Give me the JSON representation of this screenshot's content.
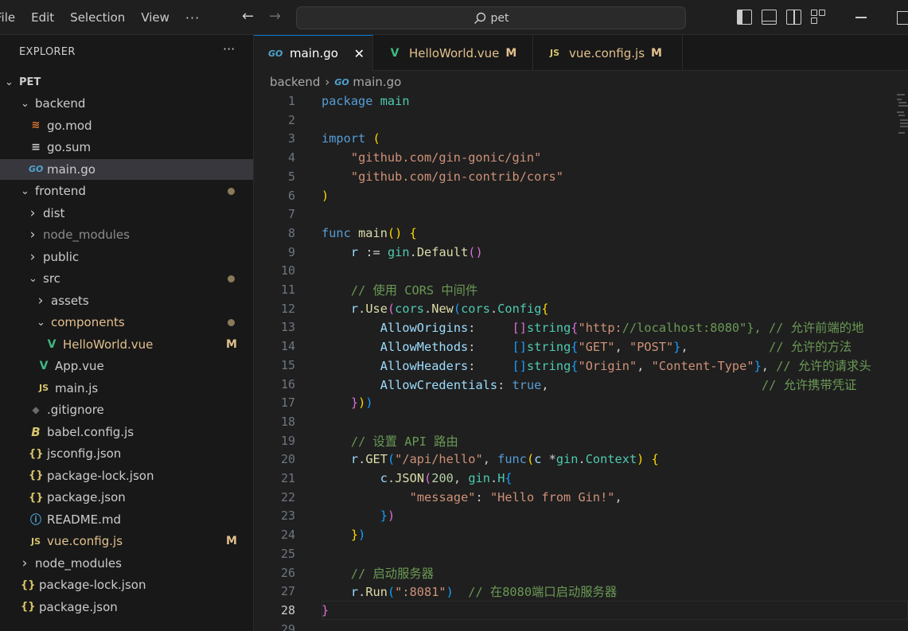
{
  "menu": [
    "File",
    "Edit",
    "Selection",
    "View"
  ],
  "search": {
    "text": "pet"
  },
  "explorer": {
    "title": "EXPLORER",
    "root": "PET",
    "items": [
      {
        "label": "backend",
        "type": "folder-open",
        "depth": 1
      },
      {
        "label": "go.mod",
        "type": "gomod",
        "depth": 2
      },
      {
        "label": "go.sum",
        "type": "gosum",
        "depth": 2
      },
      {
        "label": "main.go",
        "type": "go",
        "depth": 2,
        "selected": true
      },
      {
        "label": "frontend",
        "type": "folder-open",
        "depth": 1,
        "dot": true
      },
      {
        "label": "dist",
        "type": "folder",
        "depth": 2
      },
      {
        "label": "node_modules",
        "type": "folder",
        "depth": 2,
        "dim": true
      },
      {
        "label": "public",
        "type": "folder",
        "depth": 2
      },
      {
        "label": "src",
        "type": "folder-open",
        "depth": 2,
        "dot": true
      },
      {
        "label": "assets",
        "type": "folder",
        "depth": 3
      },
      {
        "label": "components",
        "type": "folder-open",
        "depth": 3,
        "dot": true,
        "modified": true
      },
      {
        "label": "HelloWorld.vue",
        "type": "vue",
        "depth": 4,
        "badge": "M",
        "modified": true
      },
      {
        "label": "App.vue",
        "type": "vue",
        "depth": 3
      },
      {
        "label": "main.js",
        "type": "js",
        "depth": 3
      },
      {
        "label": ".gitignore",
        "type": "git",
        "depth": 2
      },
      {
        "label": "babel.config.js",
        "type": "babel",
        "depth": 2
      },
      {
        "label": "jsconfig.json",
        "type": "json",
        "depth": 2
      },
      {
        "label": "package-lock.json",
        "type": "json",
        "depth": 2
      },
      {
        "label": "package.json",
        "type": "json",
        "depth": 2
      },
      {
        "label": "README.md",
        "type": "info",
        "depth": 2
      },
      {
        "label": "vue.config.js",
        "type": "js",
        "depth": 2,
        "badge": "M",
        "modified": true
      },
      {
        "label": "node_modules",
        "type": "folder",
        "depth": 1
      },
      {
        "label": "package-lock.json",
        "type": "json",
        "depth": 1
      },
      {
        "label": "package.json",
        "type": "json",
        "depth": 1
      }
    ]
  },
  "tabs": [
    {
      "label": "main.go",
      "icon": "GO",
      "active": true
    },
    {
      "label": "HelloWorld.vue",
      "icon": "V",
      "badge": "M"
    },
    {
      "label": "vue.config.js",
      "icon": "JS",
      "badge": "M"
    }
  ],
  "breadcrumb": [
    "backend",
    "main.go"
  ],
  "editor": {
    "current_line": 28,
    "lines": [
      "package main",
      "",
      "import (",
      "    \"github.com/gin-gonic/gin\"",
      "    \"github.com/gin-contrib/cors\"",
      ")",
      "",
      "func main() {",
      "    r := gin.Default()",
      "",
      "    // 使用 CORS 中间件",
      "    r.Use(cors.New(cors.Config{",
      "        AllowOrigins:     []string{\"http://localhost:8080\"}, // 允许前端的地",
      "        AllowMethods:     []string{\"GET\", \"POST\"},           // 允许的方法",
      "        AllowHeaders:     []string{\"Origin\", \"Content-Type\"}, // 允许的请求头",
      "        AllowCredentials: true,                             // 允许携带凭证",
      "    }))",
      "",
      "    // 设置 API 路由",
      "    r.GET(\"/api/hello\", func(c *gin.Context) {",
      "        c.JSON(200, gin.H{",
      "            \"message\": \"Hello from Gin!\",",
      "        })",
      "    })",
      "",
      "    // 启动服务器",
      "    r.Run(\":8081\")  // 在8080端口启动服务器",
      "}",
      ""
    ]
  },
  "colors": {
    "accent": "#0078d4",
    "modified": "#e2c08d",
    "go": "#4fa3d1",
    "vue": "#41b883",
    "js": "#d7c46c"
  }
}
